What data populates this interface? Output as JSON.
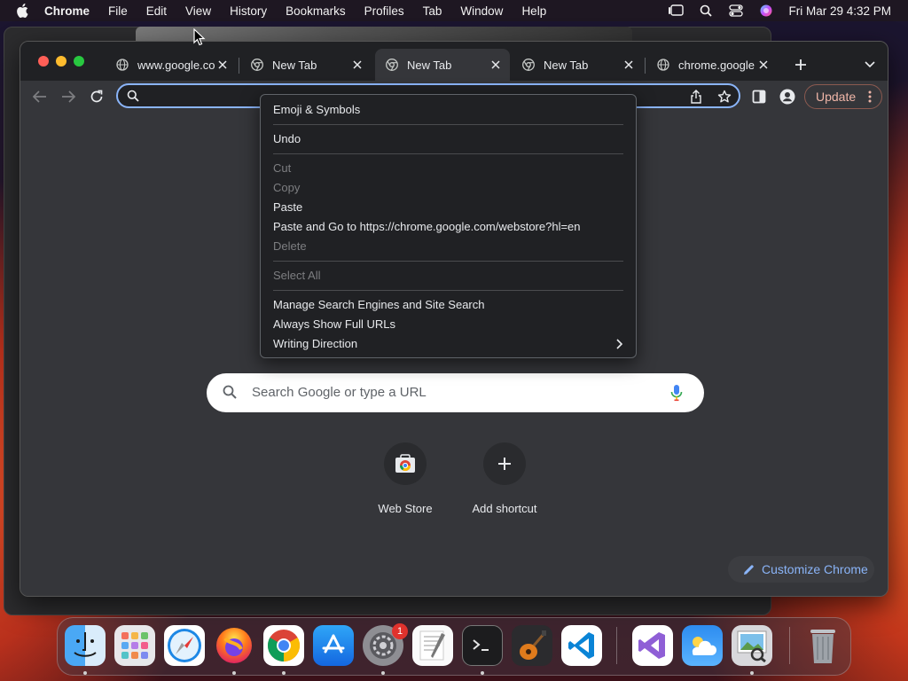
{
  "menubar": {
    "app_name": "Chrome",
    "items": [
      "File",
      "Edit",
      "View",
      "History",
      "Bookmarks",
      "Profiles",
      "Tab",
      "Window",
      "Help"
    ],
    "clock": "Fri Mar 29  4:32 PM"
  },
  "tabs": [
    {
      "title": "www.google.co",
      "icon": "globe-icon",
      "active": false
    },
    {
      "title": "New Tab",
      "icon": "chrome-icon",
      "active": false
    },
    {
      "title": "New Tab",
      "icon": "chrome-icon",
      "active": true
    },
    {
      "title": "New Tab",
      "icon": "chrome-icon",
      "active": false
    },
    {
      "title": "chrome.google",
      "icon": "globe-icon",
      "active": false
    }
  ],
  "toolbar": {
    "omnibox_value": "",
    "update_label": "Update"
  },
  "context_menu": {
    "items": [
      {
        "label": "Emoji & Symbols",
        "enabled": true
      },
      {
        "label": "Undo",
        "enabled": true
      },
      {
        "label": "Cut",
        "enabled": false
      },
      {
        "label": "Copy",
        "enabled": false
      },
      {
        "label": "Paste",
        "enabled": true
      },
      {
        "label": "Paste and Go to https://chrome.google.com/webstore?hl=en",
        "enabled": true
      },
      {
        "label": "Delete",
        "enabled": false
      },
      {
        "label": "Select All",
        "enabled": false
      },
      {
        "label": "Manage Search Engines and Site Search",
        "enabled": true
      },
      {
        "label": "Always Show Full URLs",
        "enabled": true
      },
      {
        "label": "Writing Direction",
        "enabled": true,
        "submenu": true
      }
    ]
  },
  "ntp": {
    "search_placeholder": "Search Google or type a URL",
    "shortcuts": [
      {
        "label": "Web Store",
        "icon": "web-store-icon"
      },
      {
        "label": "Add shortcut",
        "icon": "plus-icon"
      }
    ],
    "customize_label": "Customize Chrome"
  },
  "dock": {
    "apps": [
      "Finder",
      "Launchpad",
      "Safari",
      "Firefox",
      "Google Chrome",
      "App Store",
      "System Settings",
      "TextEdit",
      "Terminal",
      "GarageBand",
      "Visual Studio Code",
      "Visual Studio",
      "Weather",
      "Preview",
      "Trash"
    ],
    "system_settings_badge": "1"
  },
  "colors": {
    "accent": "#8ab4f8",
    "window_bg": "#35363a",
    "tabstrip_bg": "#202124",
    "menu_bg": "#202124",
    "update_text": "#f0b6a8"
  }
}
